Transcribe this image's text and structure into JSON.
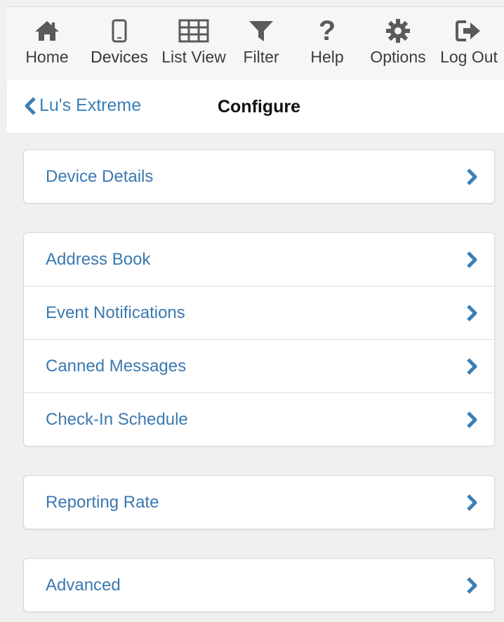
{
  "nav": {
    "items": [
      {
        "label": "Home",
        "icon": "home-icon"
      },
      {
        "label": "Devices",
        "icon": "device-icon"
      },
      {
        "label": "List View",
        "icon": "grid-icon"
      },
      {
        "label": "Filter",
        "icon": "filter-icon"
      },
      {
        "label": "Help",
        "icon": "question-icon"
      },
      {
        "label": "Options",
        "icon": "gear-icon"
      },
      {
        "label": "Log Out",
        "icon": "logout-icon"
      }
    ],
    "active": "Devices"
  },
  "header": {
    "back_label": "Lu's Extreme",
    "title": "Configure"
  },
  "groups": [
    {
      "items": [
        {
          "label": "Device Details"
        }
      ]
    },
    {
      "items": [
        {
          "label": "Address Book"
        },
        {
          "label": "Event Notifications"
        },
        {
          "label": "Canned Messages"
        },
        {
          "label": "Check-In Schedule"
        }
      ]
    },
    {
      "items": [
        {
          "label": "Reporting Rate"
        }
      ]
    },
    {
      "items": [
        {
          "label": "Advanced"
        }
      ]
    }
  ],
  "colors": {
    "accent": "#4a94cb",
    "link": "#3b79b0",
    "icon": "#5a5a5a"
  }
}
